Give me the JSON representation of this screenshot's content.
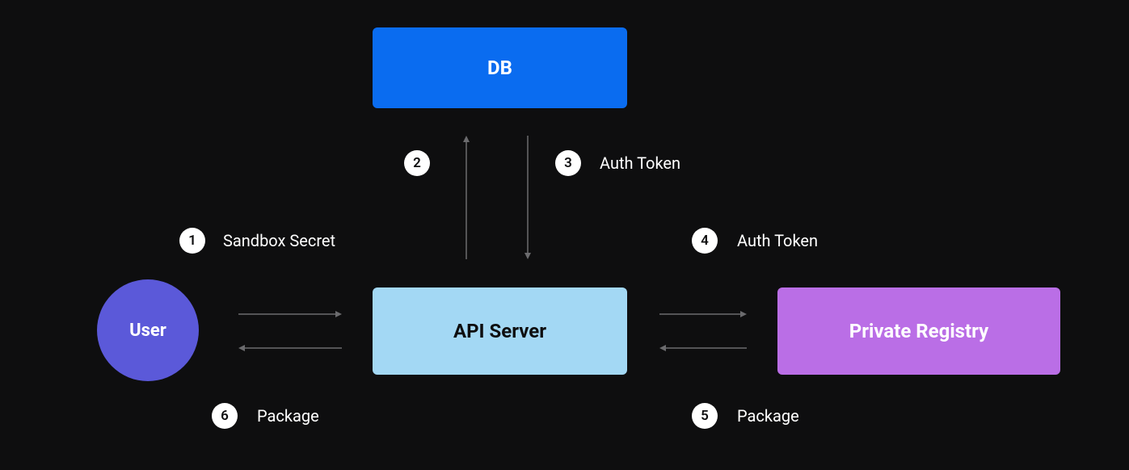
{
  "nodes": {
    "db": {
      "label": "DB"
    },
    "user": {
      "label": "User"
    },
    "api": {
      "label": "API Server"
    },
    "registry": {
      "label": "Private Registry"
    }
  },
  "steps": {
    "s1": {
      "number": "1",
      "label": "Sandbox Secret"
    },
    "s2": {
      "number": "2",
      "label": ""
    },
    "s3": {
      "number": "3",
      "label": "Auth Token"
    },
    "s4": {
      "number": "4",
      "label": "Auth Token"
    },
    "s5": {
      "number": "5",
      "label": "Package"
    },
    "s6": {
      "number": "6",
      "label": "Package"
    }
  },
  "flow_description": "User sends Sandbox Secret (1) to API Server. API Server queries DB (2), DB returns Auth Token (3). API Server sends Auth Token (4) to Private Registry. Private Registry returns Package (5) to API Server. API Server returns Package (6) to User."
}
